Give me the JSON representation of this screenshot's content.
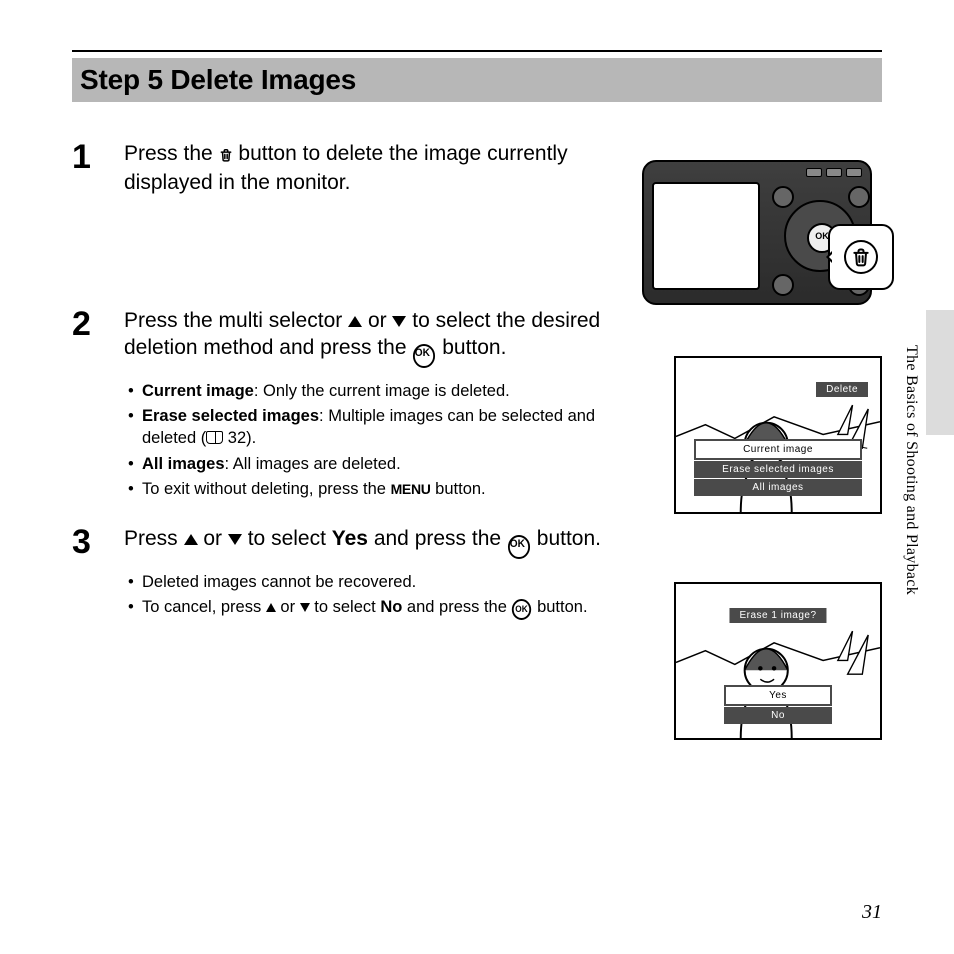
{
  "section_title": "Step 5 Delete Images",
  "side_label": "The Basics of Shooting and Playback",
  "page_number": "31",
  "steps": {
    "s1": {
      "num": "1",
      "pre": "Press the ",
      "post": " button to delete the image currently displayed in the monitor."
    },
    "s2": {
      "num": "2",
      "pre": "Press the multi selector ",
      "mid1": " or ",
      "mid2": " to select the desired deletion method and press the ",
      "post": " button.",
      "b1a": "Current image",
      "b1b": ": Only the current image is deleted.",
      "b2a": "Erase selected images",
      "b2b": ": Multiple images can be selected and deleted (",
      "b2c": " 32).",
      "b3a": "All images",
      "b3b": ": All images are deleted.",
      "b4a": "To exit without deleting, press the ",
      "b4b": " button."
    },
    "s3": {
      "num": "3",
      "pre": "Press ",
      "mid1": " or ",
      "mid2": " to select ",
      "yes": "Yes",
      "mid3": " and press the ",
      "post": " button.",
      "b1": "Deleted images cannot be recovered.",
      "b2a": "To cancel, press ",
      "b2b": " or ",
      "b2c": " to select ",
      "no": "No",
      "b2d": " and press the ",
      "b2e": " button."
    }
  },
  "lcd": {
    "s2": {
      "title": "Delete",
      "opt1": "Current image",
      "opt2": "Erase selected images",
      "opt3": "All images"
    },
    "s3": {
      "title": "Erase 1 image?",
      "opt1": "Yes",
      "opt2": "No"
    },
    "ok_label": "OK"
  }
}
